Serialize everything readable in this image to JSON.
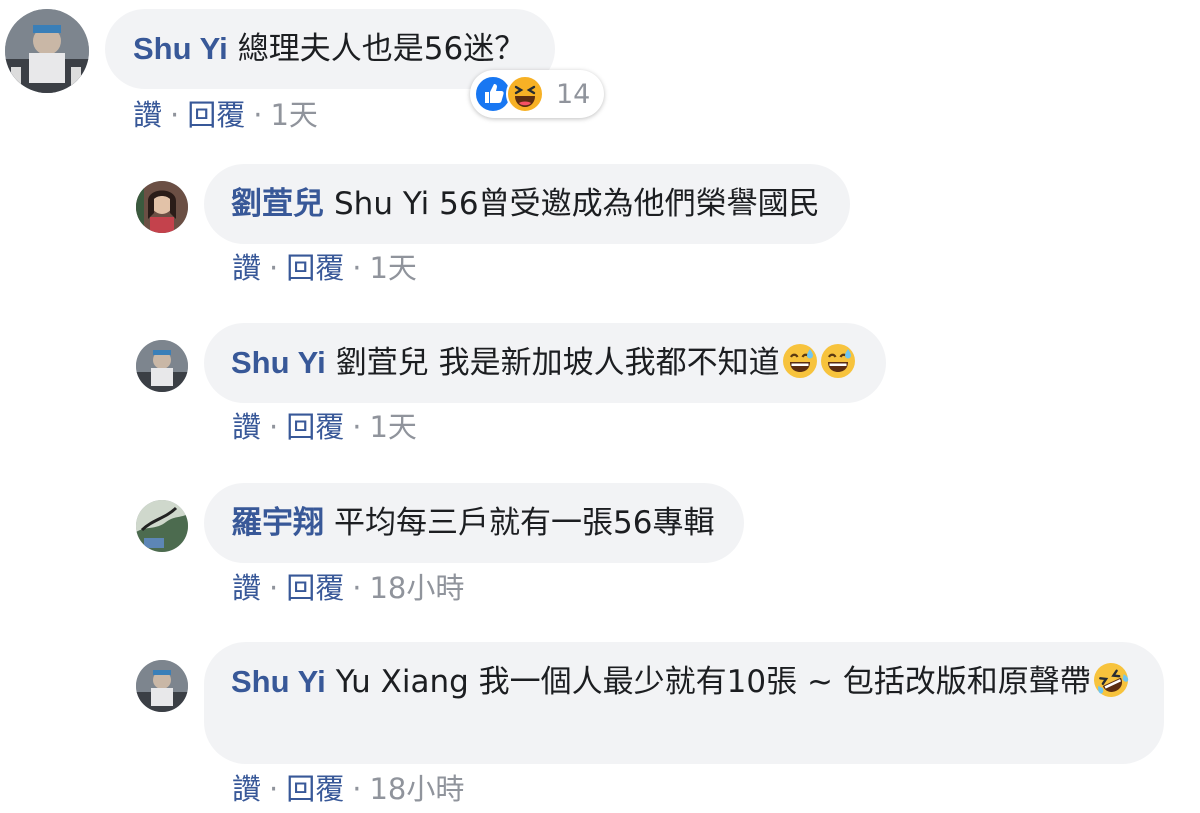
{
  "colors": {
    "author": "#385898",
    "bubble": "#f2f3f5",
    "meta": "#90949c",
    "like": "#1877f2",
    "haha": "#f7b125"
  },
  "actions": {
    "like": "讚",
    "reply": "回覆",
    "separator": "·"
  },
  "comments": [
    {
      "author": "Shu Yi",
      "text": "總理夫人也是56迷？",
      "time": "1天",
      "reactions": {
        "icons": [
          "like-icon",
          "haha-icon"
        ],
        "count": "14"
      }
    },
    {
      "author": "劉萓兒",
      "mention": "Shu Yi",
      "text": "56曾受邀成為他們榮譽國民",
      "time": "1天"
    },
    {
      "author": "Shu Yi",
      "mention": "劉萓兒",
      "text": "我是新加坡人我都不知道",
      "emoji": [
        "grinning-sweat-emoji",
        "grinning-sweat-emoji"
      ],
      "time": "1天"
    },
    {
      "author": "羅宇翔",
      "text": "平均每三戶就有一張56專輯",
      "time": "18小時"
    },
    {
      "author": "Shu Yi",
      "mention": "Yu Xiang",
      "text": "我一個人最少就有10張 ~ 包括改版和原聲帶",
      "emoji": [
        "rolling-laughing-emoji"
      ],
      "time": "18小時"
    }
  ]
}
